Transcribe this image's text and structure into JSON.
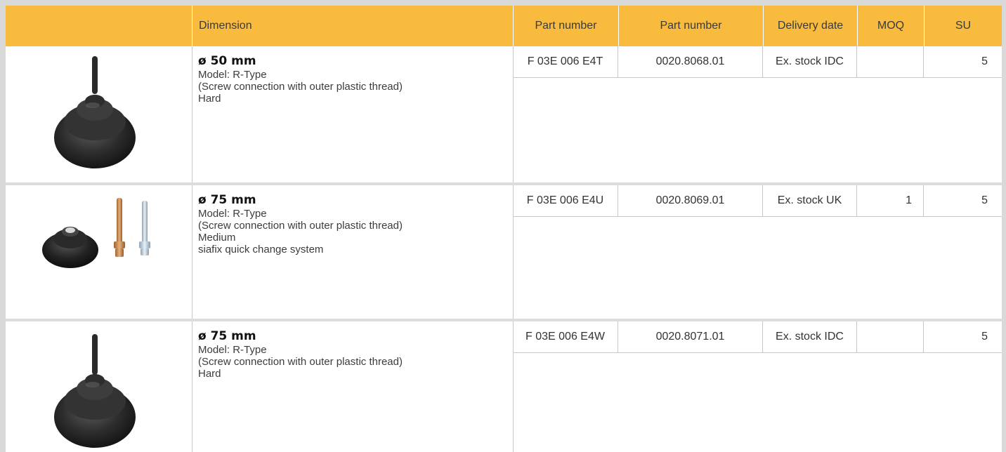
{
  "header": {
    "dimension": "Dimension",
    "part_number_1": "Part number",
    "part_number_2": "Part number",
    "delivery_date": "Delivery date",
    "moq": "MOQ",
    "su": "SU"
  },
  "rows": [
    {
      "title": "ø 50 mm",
      "lines": [
        "Model: R-Type",
        "(Screw connection with outer plastic thread)",
        "Hard"
      ],
      "part_number_1": "F 03E 006 E4T",
      "part_number_2": "0020.8068.01",
      "delivery_date": "Ex. stock IDC",
      "moq": "",
      "su": "5",
      "image_icon": "backing-pad-with-shaft"
    },
    {
      "title": "ø 75 mm",
      "lines": [
        "Model: R-Type",
        "(Screw connection with outer plastic thread)",
        "Medium",
        "siafix quick change system"
      ],
      "part_number_1": "F 03E 006 E4U",
      "part_number_2": "0020.8069.01",
      "delivery_date": "Ex. stock UK",
      "moq": "1",
      "su": "5",
      "image_icon": "backing-pad-with-screws"
    },
    {
      "title": "ø 75 mm",
      "lines": [
        "Model: R-Type",
        "(Screw connection with outer plastic thread)",
        "Hard"
      ],
      "part_number_1": "F 03E 006 E4W",
      "part_number_2": "0020.8071.01",
      "delivery_date": "Ex. stock IDC",
      "moq": "",
      "su": "5",
      "image_icon": "backing-pad-with-shaft"
    }
  ],
  "colors": {
    "header_bg": "#f9bb3d",
    "page_bg": "#d9d9d9",
    "grid_line": "#c8c8c8"
  }
}
